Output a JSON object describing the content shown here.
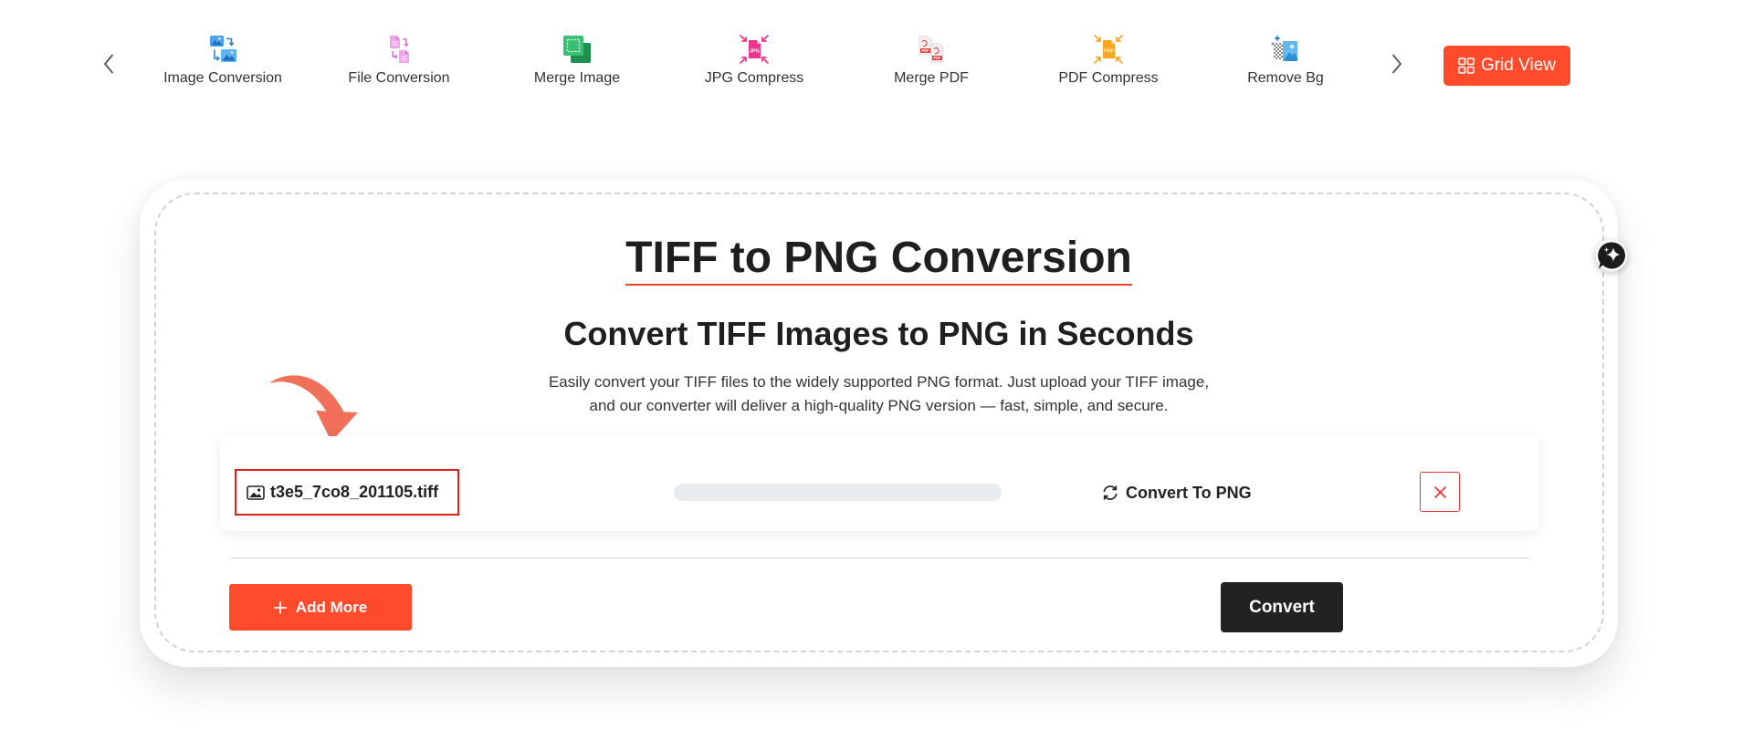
{
  "nav": {
    "prev_icon": "chevron-left-icon",
    "next_icon": "chevron-right-icon",
    "tools": [
      {
        "label": "Image Conversion",
        "icon": "image-conversion-icon"
      },
      {
        "label": "File Conversion",
        "icon": "file-conversion-icon"
      },
      {
        "label": "Merge Image",
        "icon": "merge-image-icon"
      },
      {
        "label": "JPG Compress",
        "icon": "jpg-compress-icon",
        "badge": "JPG"
      },
      {
        "label": "Merge PDF",
        "icon": "merge-pdf-icon",
        "badge": "PDF"
      },
      {
        "label": "PDF Compress",
        "icon": "pdf-compress-icon",
        "badge": "PDF"
      },
      {
        "label": "Remove Bg",
        "icon": "remove-bg-icon"
      }
    ],
    "grid_view": {
      "label": "Grid View",
      "icon": "grid-icon"
    }
  },
  "converter": {
    "title": "TIFF to PNG Conversion",
    "subtitle": "Convert TIFF Images to PNG in Seconds",
    "description": [
      "Easily convert your TIFF files to the widely supported PNG format. Just upload your TIFF image,",
      "and our converter will deliver a high-quality PNG version — fast, simple, and secure."
    ],
    "file": {
      "name": "t3e5_7co8_201105.tiff",
      "icon": "image-file-icon",
      "progress_percent": 0,
      "action_label": "Convert To PNG",
      "action_icon": "refresh-icon",
      "remove_icon": "close-icon"
    },
    "add_more": {
      "label": "Add More",
      "icon": "plus-icon"
    },
    "convert": {
      "label": "Convert"
    }
  },
  "assistant": {
    "icon": "ai-chat-sparkle-icon"
  },
  "colors": {
    "accent": "#fd4b2c",
    "underline": "#e8432a",
    "danger": "#e53935",
    "dark": "#222222",
    "track": "#e9ecef",
    "highlight": "#d9261c",
    "arrow": "#f0705a"
  }
}
